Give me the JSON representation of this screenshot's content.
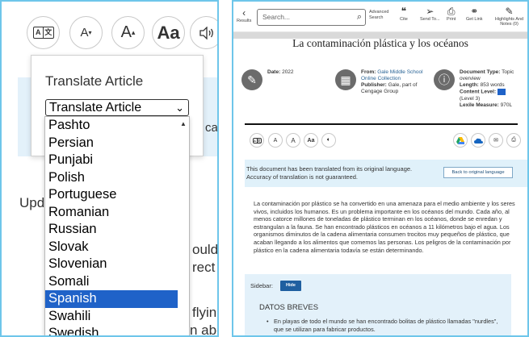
{
  "left": {
    "toolbar": {
      "translate_glyphs": [
        "A",
        "文"
      ],
      "font_decrease": "A",
      "font_increase": "A",
      "font_style": "Aa"
    },
    "popup": {
      "title": "Translate Article",
      "select_value": "Translate Article"
    },
    "background_fragments": {
      "cat": "cat",
      "upd": "Upd",
      "ould": "ould",
      "rect": "rect",
      "flyin": "flyin",
      "n_abo": "n abo"
    },
    "languages": [
      "Pashto",
      "Persian",
      "Punjabi",
      "Polish",
      "Portuguese",
      "Romanian",
      "Russian",
      "Slovak",
      "Slovenian",
      "Somali",
      "Spanish",
      "Swahili",
      "Swedish"
    ],
    "selected_language": "Spanish"
  },
  "right": {
    "toolbar": {
      "results": "Results",
      "search_placeholder": "Search...",
      "advanced": [
        "Advanced",
        "Search"
      ],
      "cite": "Cite",
      "send_to": "Send To...",
      "print": "Print",
      "get_link": "Get Link",
      "highlights": "Highlights And Notes (0)"
    },
    "title": "La contaminación plástica y los océanos",
    "meta": {
      "date_label": "Date:",
      "date_value": "2022",
      "from_label": "From:",
      "from_value": "Gale Middle School Online Collection",
      "publisher_label": "Publisher:",
      "publisher_value": "Gale, part of Cengage Group",
      "doctype_label": "Document Type:",
      "doctype_value": "Topic overview",
      "length_label": "Length:",
      "length_value": "853 words",
      "content_label": "Content Level:",
      "content_value": "(Level 3)",
      "lexile_label": "Lexile Measure:",
      "lexile_value": "970L"
    },
    "notice": {
      "text": "This document has been translated from its original language. Accuracy of translation is not guaranteed.",
      "back_button": "Back to original language"
    },
    "body": "La contaminación por plástico se ha convertido en una amenaza para el medio ambiente y los seres vivos, incluidos los humanos. Es un problema importante en los océanos del mundo. Cada año, al menos catorce millones de toneladas de plástico terminan en los océanos, donde se enredan y estrangulan a la fauna. Se han encontrado plásticos en océanos a 11 kilómetros bajo el agua. Los organismos diminutos de la cadena alimentaria consumen trocitos muy pequeños de plástico, que acaban llegando a los alimentos que comemos las personas. Los peligros de la contaminación por plástico en la cadena alimentaria todavía se están determinando.",
    "sidebar": {
      "label": "Sidebar:",
      "hide_button": "Hide",
      "heading": "DATOS BREVES",
      "bullet": "En playas de todo el mundo se han encontrado bolitas de plástico llamadas \"nurdles\", que se utilizan para fabricar productos."
    }
  },
  "colors": {
    "panel_border": "#6ec6ea",
    "selected_option": "#1f62c8",
    "notice_bg": "#e0f1fa",
    "hide_button": "#1f5fa0"
  }
}
